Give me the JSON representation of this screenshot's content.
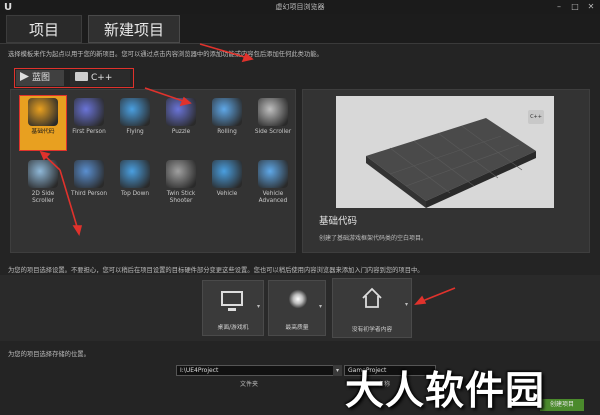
{
  "window": {
    "title": "虚幻项目浏览器",
    "minimize": "–",
    "maximize": "□",
    "close": "✕"
  },
  "tabs": {
    "project": "项目",
    "new_project": "新建项目"
  },
  "hint": "选择模板来作为起点以用于您的新项目。您可以通过点击内容浏览器中的添加功能或内容包后添加任何此类功能。",
  "subtabs": {
    "blueprint": "蓝图",
    "cpp": "C++"
  },
  "templates": [
    {
      "label": "基础代码",
      "color": "#e8a020"
    },
    {
      "label": "First Person",
      "color": "#6a74d8"
    },
    {
      "label": "Flying",
      "color": "#4a9fe0"
    },
    {
      "label": "Puzzle",
      "color": "#6a74d8"
    },
    {
      "label": "Rolling",
      "color": "#5fa8e8"
    },
    {
      "label": "Side Scroller",
      "color": "#bfbfbf"
    },
    {
      "label": "2D Side Scroller",
      "color": "#8fb8d8"
    },
    {
      "label": "Third Person",
      "color": "#5a8fd0"
    },
    {
      "label": "Top Down",
      "color": "#4a9fe0"
    },
    {
      "label": "Twin Stick Shooter",
      "color": "#a0a0a0"
    },
    {
      "label": "Vehicle",
      "color": "#4a9fe0"
    },
    {
      "label": "Vehicle Advanced",
      "color": "#5fa8e8"
    }
  ],
  "preview": {
    "name": "基础代码",
    "desc": "创建了基础游戏框架代码类的空白项目。",
    "badge": "C++"
  },
  "settings_hint": "为您的项目选择设置。不要担心，您可以稍后在项目设置的目标硬件部分变更这些设置。您也可以稍后使用内容浏览器来添加入门内容到您的项目中。",
  "settings": {
    "desktop": "桌面/游戏机",
    "quality": "最高质量",
    "starter": "没有初学者内容"
  },
  "location_hint": "为您的项目选择存储的位置。",
  "location": {
    "path": "I:\\UE4Project",
    "path_label": "文件夹",
    "name": "GameProject",
    "name_label": "名称"
  },
  "create_button": "创建项目",
  "watermark": "大人软件园"
}
